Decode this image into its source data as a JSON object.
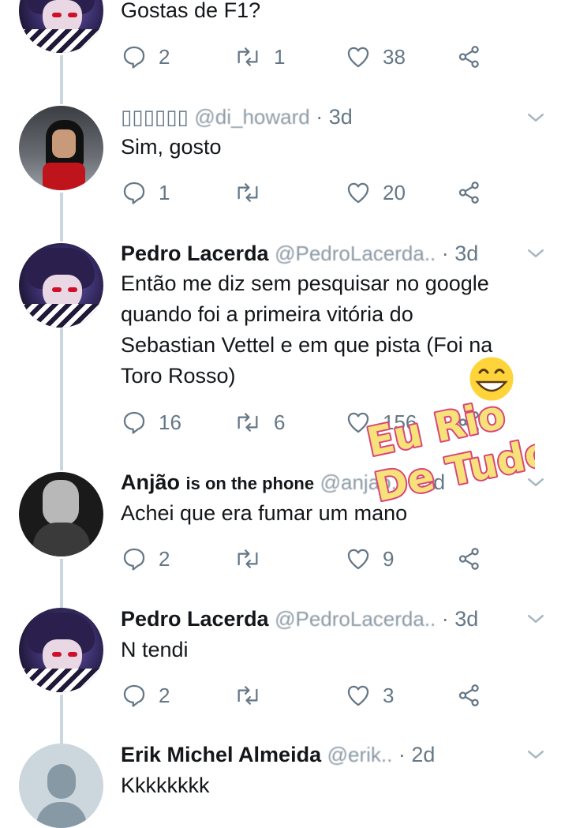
{
  "tweets": [
    {
      "body": "Gostas de F1?",
      "reply_count": "2",
      "retweet_count": "1",
      "like_count": "38"
    },
    {
      "name_display": "▯▯▯▯▯▯",
      "handle": "@di_howard",
      "time": "· 3d",
      "body": "Sim, gosto",
      "reply_count": "1",
      "retweet_count": "",
      "like_count": "20"
    },
    {
      "name": "Pedro Lacerda",
      "handle": "@PedroLacerda..",
      "time": "· 3d",
      "body_lines": [
        "Então me diz sem pesquisar no google",
        "quando foi a primeira vitória do",
        "Sebastian Vettel e em que pista (Foi na",
        "Toro Rosso)"
      ],
      "reply_count": "16",
      "retweet_count": "6",
      "like_count": "156"
    },
    {
      "name": "Anjão",
      "name_extra": "is on the phone",
      "handle": "@anjao..",
      "time": "· 3d",
      "body": "Achei que era fumar um mano",
      "reply_count": "2",
      "retweet_count": "",
      "like_count": "9"
    },
    {
      "name": "Pedro Lacerda",
      "handle": "@PedroLacerda..",
      "time": "· 3d",
      "body": "N tendi",
      "reply_count": "2",
      "retweet_count": "",
      "like_count": "3"
    },
    {
      "name": "Erik Michel Almeida",
      "handle": "@erik..",
      "time": "· 2d",
      "body": "Kkkkkkkk"
    }
  ],
  "watermark": {
    "line1": "Eu Rio",
    "line2": "De Tudo",
    "colors": {
      "fill": "#f7e27a",
      "stroke": "#d8467a",
      "emoji": "#ffd43b"
    }
  },
  "colors": {
    "muted": "#657786",
    "text": "#14171a",
    "thread_line": "#ccd6dd"
  }
}
